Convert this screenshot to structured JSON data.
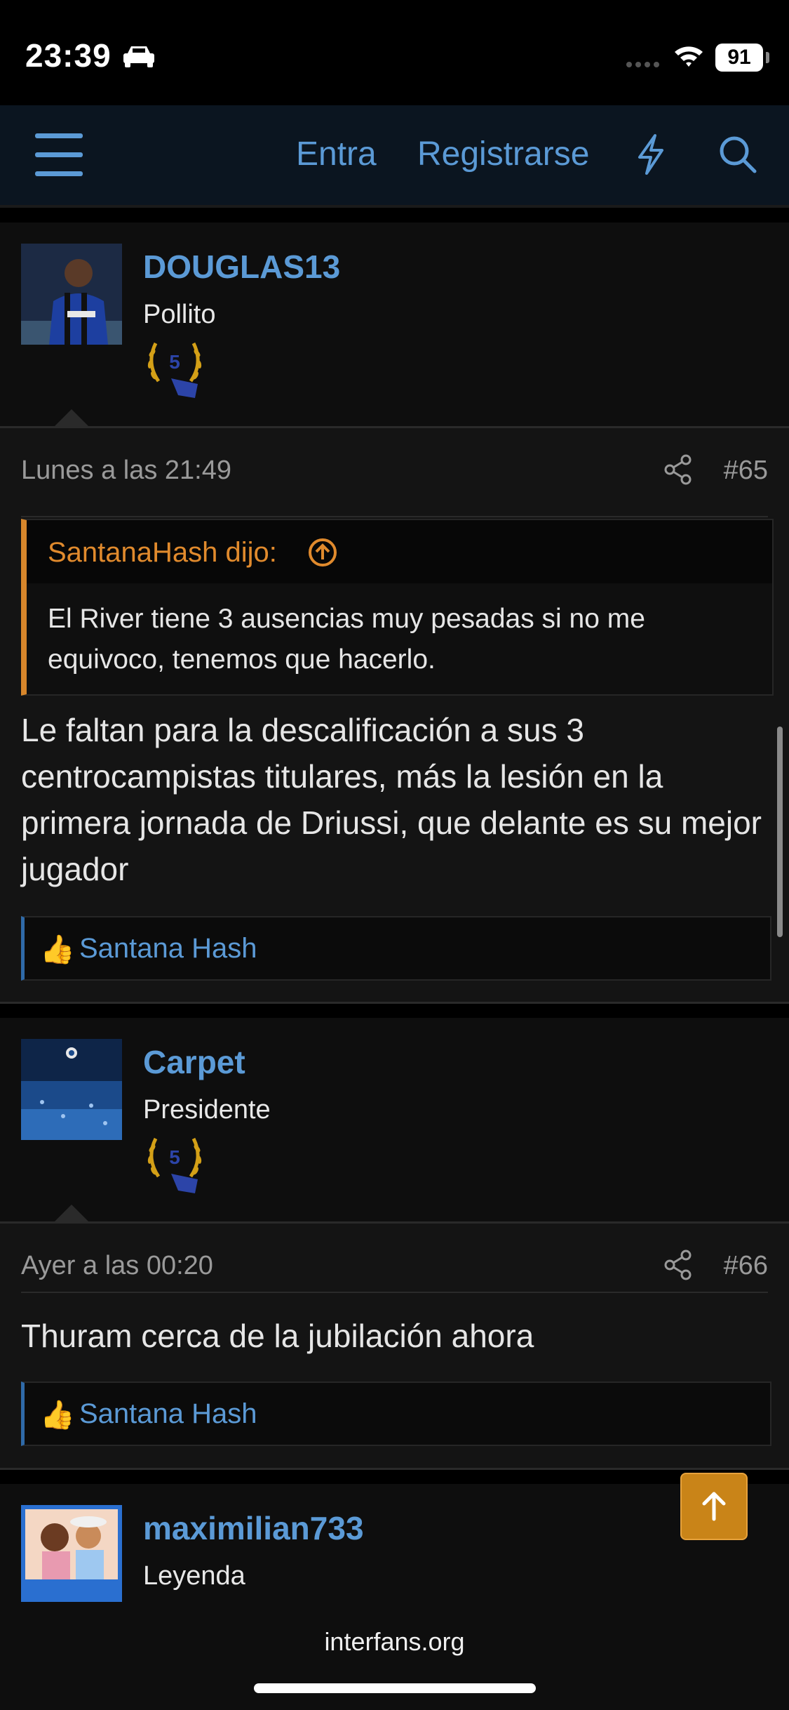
{
  "status": {
    "time": "23:39",
    "battery": "91"
  },
  "nav": {
    "login": "Entra",
    "register": "Registrarse"
  },
  "posts": [
    {
      "username": "DOUGLAS13",
      "user_title": "Pollito",
      "badge_level": "5",
      "time": "Lunes a las 21:49",
      "number": "#65",
      "quote_author": "SantanaHash dijo:",
      "quote_text": "El River tiene 3 ausencias muy pesadas si no me equivoco, tenemos que hacerlo.",
      "body": "Le faltan para la descalificación a sus 3 centrocampistas titulares, más la lesión en la primera jornada de Driussi, que delante es su mejor jugador",
      "reaction_emoji": "👍",
      "reaction_name": "Santana Hash"
    },
    {
      "username": "Carpet",
      "user_title": "Presidente",
      "badge_level": "5",
      "time": "Ayer a las 00:20",
      "number": "#66",
      "body": "Thuram cerca de la jubilación ahora",
      "reaction_emoji": "👍",
      "reaction_name": "Santana Hash"
    },
    {
      "username": "maximilian733",
      "user_title": "Leyenda"
    }
  ],
  "footer": {
    "url": "interfans.org"
  },
  "colors": {
    "accent": "#5b9ad6",
    "quote": "#e08a2d",
    "scroll_top": "#c98418"
  }
}
